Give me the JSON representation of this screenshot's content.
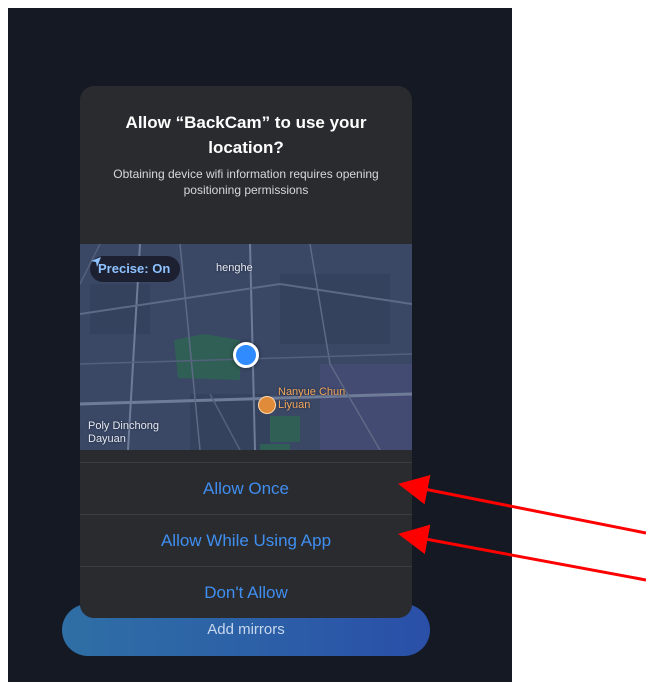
{
  "background_button": {
    "label": "Add mirrors"
  },
  "alert": {
    "title": "Allow “BackCam” to use your location?",
    "message": "Obtaining device wifi information requires opening positioning permissions",
    "map": {
      "precise_label": "Precise: On",
      "labels": {
        "top": "henghe",
        "poi": "Nanyue Chun Liyuan",
        "bottom_left": "Poly Dinchong Dayuan"
      }
    },
    "buttons": {
      "allow_once": "Allow Once",
      "allow_while_using": "Allow While Using App",
      "dont_allow": "Don't Allow"
    }
  },
  "colors": {
    "accent": "#3f8ef0",
    "annotation_arrow": "#ff0000",
    "dialog_bg": "#2a2b2f"
  }
}
